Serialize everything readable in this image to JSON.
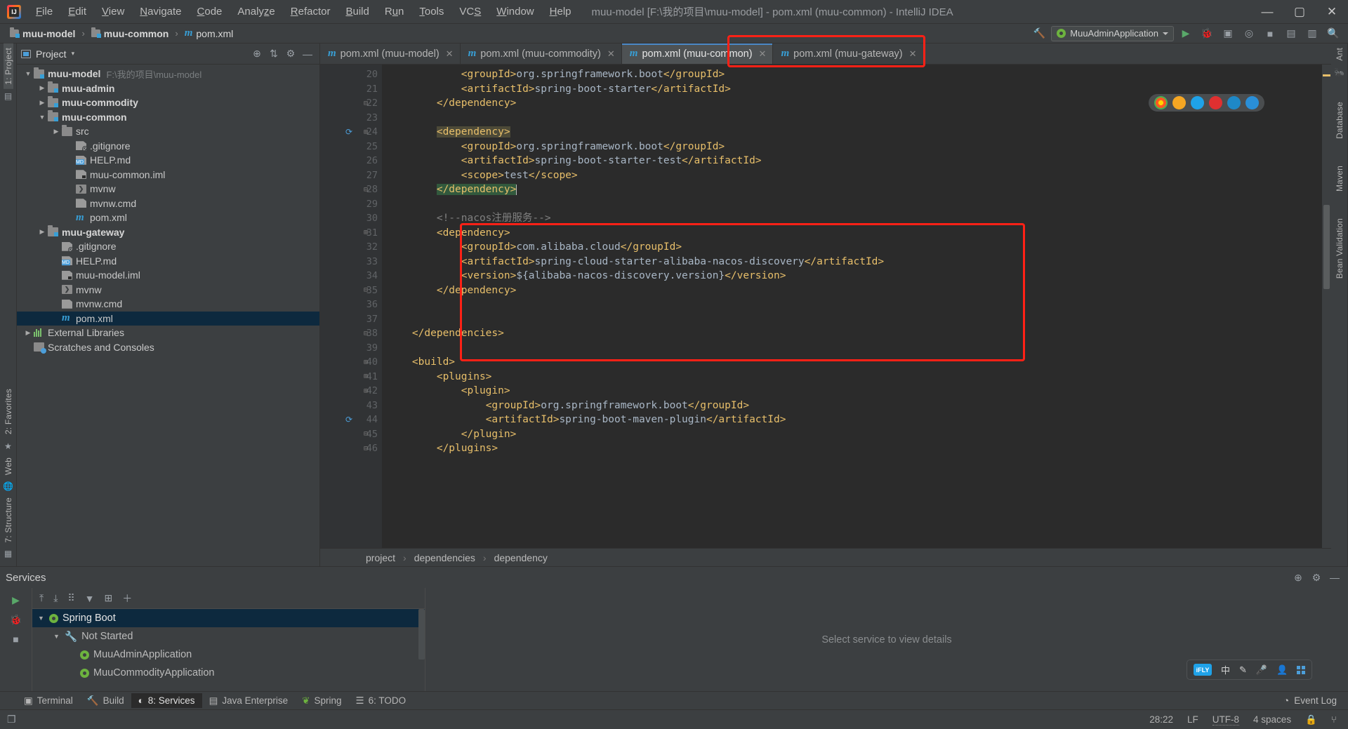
{
  "window": {
    "title": "muu-model [F:\\我的项目\\muu-model] - pom.xml (muu-common) - IntelliJ IDEA",
    "minimize": "—",
    "maximize": "▢",
    "close": "✕"
  },
  "menu": {
    "items": [
      "File",
      "Edit",
      "View",
      "Navigate",
      "Code",
      "Analyze",
      "Refactor",
      "Build",
      "Run",
      "Tools",
      "VCS",
      "Window",
      "Help"
    ]
  },
  "breadcrumb_nav": {
    "items": [
      "muu-model",
      "muu-common",
      "pom.xml"
    ],
    "separator": "›"
  },
  "toolbar": {
    "run_config": "MuuAdminApplication",
    "run_label": "▶",
    "debug_label": "🐞",
    "coverage_label": "▣",
    "profile_label": "◎",
    "stop_label": "■",
    "layout_label": "▤",
    "updates_label": "▥",
    "search_label": "🔍",
    "hammer_label": "🔨"
  },
  "project_panel": {
    "title": "Project",
    "dropdown": "▾",
    "icons": [
      "locate-icon",
      "collapse-icon",
      "settings-icon",
      "hide-icon"
    ],
    "tree": [
      {
        "label": "muu-model",
        "path": "F:\\我的项目\\muu-model",
        "indent": 0,
        "arrow": "▼",
        "icon": "folder-module",
        "bold": true,
        "selected": false
      },
      {
        "label": "muu-admin",
        "path": "",
        "indent": 1,
        "arrow": "▶",
        "icon": "folder-module",
        "bold": true,
        "selected": false
      },
      {
        "label": "muu-commodity",
        "path": "",
        "indent": 1,
        "arrow": "▶",
        "icon": "folder-module",
        "bold": true,
        "selected": false
      },
      {
        "label": "muu-common",
        "path": "",
        "indent": 1,
        "arrow": "▼",
        "icon": "folder-module",
        "bold": true,
        "selected": false
      },
      {
        "label": "src",
        "path": "",
        "indent": 2,
        "arrow": "▶",
        "icon": "folder",
        "bold": false,
        "selected": false
      },
      {
        "label": ".gitignore",
        "path": "",
        "indent": 3,
        "arrow": "",
        "icon": "file-gitignore",
        "bold": false,
        "selected": false
      },
      {
        "label": "HELP.md",
        "path": "",
        "indent": 3,
        "arrow": "",
        "icon": "file-md",
        "bold": false,
        "selected": false
      },
      {
        "label": "muu-common.iml",
        "path": "",
        "indent": 3,
        "arrow": "",
        "icon": "file-iml",
        "bold": false,
        "selected": false
      },
      {
        "label": "mvnw",
        "path": "",
        "indent": 3,
        "arrow": "",
        "icon": "file-sh",
        "bold": false,
        "selected": false
      },
      {
        "label": "mvnw.cmd",
        "path": "",
        "indent": 3,
        "arrow": "",
        "icon": "file-cmd",
        "bold": false,
        "selected": false
      },
      {
        "label": "pom.xml",
        "path": "",
        "indent": 3,
        "arrow": "",
        "icon": "file-maven",
        "bold": false,
        "selected": false
      },
      {
        "label": "muu-gateway",
        "path": "",
        "indent": 1,
        "arrow": "▶",
        "icon": "folder-module",
        "bold": true,
        "selected": false
      },
      {
        "label": ".gitignore",
        "path": "",
        "indent": 2,
        "arrow": "",
        "icon": "file-gitignore",
        "bold": false,
        "selected": false
      },
      {
        "label": "HELP.md",
        "path": "",
        "indent": 2,
        "arrow": "",
        "icon": "file-md",
        "bold": false,
        "selected": false
      },
      {
        "label": "muu-model.iml",
        "path": "",
        "indent": 2,
        "arrow": "",
        "icon": "file-iml",
        "bold": false,
        "selected": false
      },
      {
        "label": "mvnw",
        "path": "",
        "indent": 2,
        "arrow": "",
        "icon": "file-sh",
        "bold": false,
        "selected": false
      },
      {
        "label": "mvnw.cmd",
        "path": "",
        "indent": 2,
        "arrow": "",
        "icon": "file-cmd",
        "bold": false,
        "selected": false
      },
      {
        "label": "pom.xml",
        "path": "",
        "indent": 2,
        "arrow": "",
        "icon": "file-maven",
        "bold": false,
        "selected": true
      },
      {
        "label": "External Libraries",
        "path": "",
        "indent": 0,
        "arrow": "▶",
        "icon": "libraries",
        "bold": false,
        "selected": false
      },
      {
        "label": "Scratches and Consoles",
        "path": "",
        "indent": 0,
        "arrow": "",
        "icon": "scratches",
        "bold": false,
        "selected": false
      }
    ]
  },
  "left_strip": {
    "project_tab": "1: Project",
    "favorites_tab": "2: Favorites",
    "web_tab": "Web",
    "structure_tab": "7: Structure"
  },
  "right_strip": {
    "ant_tab": "Ant",
    "database_tab": "Database",
    "maven_tab": "Maven",
    "bean_validation_tab": "Bean Validation"
  },
  "editor_tabs": [
    {
      "label": "pom.xml (muu-model)",
      "active": false,
      "close": "✕"
    },
    {
      "label": "pom.xml (muu-commodity)",
      "active": false,
      "close": "✕"
    },
    {
      "label": "pom.xml (muu-common)",
      "active": true,
      "close": "✕"
    },
    {
      "label": "pom.xml (muu-gateway)",
      "active": false,
      "close": "✕"
    }
  ],
  "editor": {
    "first_line_number": 20,
    "lines": [
      {
        "n": 20,
        "html": "            <span class='tag'>&lt;groupId&gt;</span>org.springframework.boot<span class='tag'>&lt;/groupId&gt;</span>",
        "fold": "",
        "marker": ""
      },
      {
        "n": 21,
        "html": "            <span class='tag'>&lt;artifactId&gt;</span>spring-boot-starter<span class='tag'>&lt;/artifactId&gt;</span>",
        "fold": "",
        "marker": ""
      },
      {
        "n": 22,
        "html": "        <span class='tag'>&lt;/dependency&gt;</span>",
        "fold": "⊟",
        "marker": ""
      },
      {
        "n": 23,
        "html": "",
        "fold": "",
        "marker": ""
      },
      {
        "n": 24,
        "html": "        <span class='idhl'><span class='tag'>&lt;dependency&gt;</span></span>",
        "fold": "⊞",
        "marker": "maven-reimport"
      },
      {
        "n": 25,
        "html": "            <span class='tag'>&lt;groupId&gt;</span>org.springframework.boot<span class='tag'>&lt;/groupId&gt;</span>",
        "fold": "",
        "marker": ""
      },
      {
        "n": 26,
        "html": "            <span class='tag'>&lt;artifactId&gt;</span>spring-boot-starter-test<span class='tag'>&lt;/artifactId&gt;</span>",
        "fold": "",
        "marker": ""
      },
      {
        "n": 27,
        "html": "            <span class='tag'>&lt;scope&gt;</span>test<span class='tag'>&lt;/scope&gt;</span>",
        "fold": "",
        "marker": ""
      },
      {
        "n": 28,
        "html": "        <span class='selhl'><span class='tag'>&lt;/dependency&gt;</span></span><span class='caret-bar'></span>",
        "fold": "⊟",
        "marker": ""
      },
      {
        "n": 29,
        "html": "",
        "fold": "",
        "marker": ""
      },
      {
        "n": 30,
        "html": "        <span class='cmt'>&lt;!--nacos注册服务--&gt;</span>",
        "fold": "",
        "marker": ""
      },
      {
        "n": 31,
        "html": "        <span class='tag'>&lt;dependency&gt;</span>",
        "fold": "⊞",
        "marker": ""
      },
      {
        "n": 32,
        "html": "            <span class='tag'>&lt;groupId&gt;</span>com.alibaba.cloud<span class='tag'>&lt;/groupId&gt;</span>",
        "fold": "",
        "marker": ""
      },
      {
        "n": 33,
        "html": "            <span class='tag'>&lt;artifactId&gt;</span>spring-cloud-starter-alibaba-nacos-discovery<span class='tag'>&lt;/artifactId&gt;</span>",
        "fold": "",
        "marker": ""
      },
      {
        "n": 34,
        "html": "            <span class='tag'>&lt;version&gt;</span>${alibaba-nacos-discovery.version}<span class='tag'>&lt;/version&gt;</span>",
        "fold": "",
        "marker": ""
      },
      {
        "n": 35,
        "html": "        <span class='tag'>&lt;/dependency&gt;</span>",
        "fold": "⊟",
        "marker": ""
      },
      {
        "n": 36,
        "html": "",
        "fold": "",
        "marker": ""
      },
      {
        "n": 37,
        "html": "",
        "fold": "",
        "marker": ""
      },
      {
        "n": 38,
        "html": "    <span class='tag'>&lt;/dependencies&gt;</span>",
        "fold": "⊟",
        "marker": ""
      },
      {
        "n": 39,
        "html": "",
        "fold": "",
        "marker": ""
      },
      {
        "n": 40,
        "html": "    <span class='tag'>&lt;build&gt;</span>",
        "fold": "⊞",
        "marker": ""
      },
      {
        "n": 41,
        "html": "        <span class='tag'>&lt;plugins&gt;</span>",
        "fold": "⊞",
        "marker": ""
      },
      {
        "n": 42,
        "html": "            <span class='tag'>&lt;plugin&gt;</span>",
        "fold": "⊞",
        "marker": ""
      },
      {
        "n": 43,
        "html": "                <span class='tag'>&lt;groupId&gt;</span>org.springframework.boot<span class='tag'>&lt;/groupId&gt;</span>",
        "fold": "",
        "marker": ""
      },
      {
        "n": 44,
        "html": "                <span class='tag'>&lt;artifactId&gt;</span>spring-boot-maven-plugin<span class='tag'>&lt;/artifactId&gt;</span>",
        "fold": "",
        "marker": "maven-reimport"
      },
      {
        "n": 45,
        "html": "            <span class='tag'>&lt;/plugin&gt;</span>",
        "fold": "⊟",
        "marker": ""
      },
      {
        "n": 46,
        "html": "        <span class='tag'>&lt;/plugins&gt;</span>",
        "fold": "⊟",
        "marker": ""
      }
    ]
  },
  "editor_breadcrumb": {
    "items": [
      "project",
      "dependencies",
      "dependency"
    ],
    "separator": "›"
  },
  "services": {
    "title": "Services",
    "toolbar_icons": [
      "run-icon",
      "debug-icon",
      "stop-icon"
    ],
    "tree_toolbar_icons": [
      "expand-all-icon",
      "collapse-all-icon",
      "group-icon",
      "filter-icon",
      "add-tab-icon",
      "add-icon"
    ],
    "tree": [
      {
        "label": "Spring Boot",
        "indent": 0,
        "arrow": "▼",
        "icon": "spring-icon",
        "selected": true
      },
      {
        "label": "Not Started",
        "indent": 1,
        "arrow": "▼",
        "icon": "wrench-icon",
        "selected": false
      },
      {
        "label": "MuuAdminApplication",
        "indent": 2,
        "arrow": "",
        "icon": "spring-icon",
        "selected": false
      },
      {
        "label": "MuuCommodityApplication",
        "indent": 2,
        "arrow": "",
        "icon": "spring-icon",
        "selected": false
      }
    ],
    "detail_placeholder": "Select service to view details",
    "header_icons": [
      "locate-icon",
      "settings-icon",
      "hide-icon"
    ]
  },
  "bottom_tool_windows": [
    {
      "label": "Terminal",
      "icon": "terminal-icon",
      "selected": false
    },
    {
      "label": "Build",
      "icon": "build-icon",
      "selected": false
    },
    {
      "label": "8: Services",
      "icon": "services-icon",
      "selected": true
    },
    {
      "label": "Java Enterprise",
      "icon": "java-enterprise-icon",
      "selected": false
    },
    {
      "label": "Spring",
      "icon": "spring-leaf-icon",
      "selected": false
    },
    {
      "label": "6: TODO",
      "icon": "todo-icon",
      "selected": false
    }
  ],
  "status_bar": {
    "event_log": "Event Log",
    "caret_position": "28:22",
    "line_separator": "LF",
    "encoding": "UTF-8",
    "indent": "4 spaces",
    "lock_icon": "🔒",
    "git_icon": "⑂"
  },
  "floating_browsers": {
    "dots": [
      "#ff6b2c",
      "#f5a623",
      "#1fa2e8",
      "#e03030",
      "#1e88c7",
      "#2a8fd8"
    ]
  },
  "ime_bar": {
    "logo": "iFLY",
    "mode": "中",
    "items": [
      "✎",
      "🎤",
      "👤",
      "⊞"
    ]
  },
  "colors": {
    "accent": "#4a88c7",
    "selection": "#0d293e",
    "highlight_box": "#ff2116",
    "panel_bg": "#3c3f41",
    "editor_bg": "#2b2b2b",
    "gutter_bg": "#313335",
    "tag_color": "#e8bf6a",
    "comment_color": "#808080"
  }
}
